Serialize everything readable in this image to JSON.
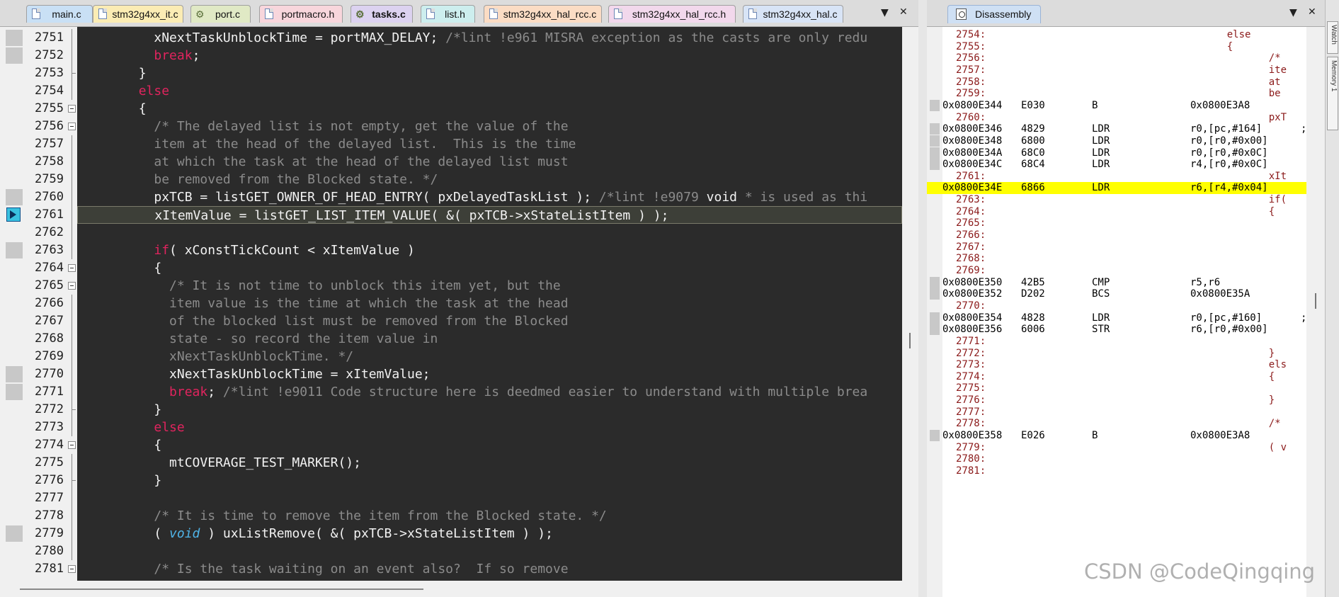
{
  "editor": {
    "tabs": [
      {
        "label": "main.c",
        "color": "#c9e0f5",
        "icon": "file-icon"
      },
      {
        "label": "stm32g4xx_it.c",
        "color": "#fbecb4",
        "icon": "file-icon"
      },
      {
        "label": "port.c",
        "color": "#e0e9c5",
        "icon": "gear-icon"
      },
      {
        "label": "portmacro.h",
        "color": "#f8d6dc",
        "icon": "file-icon"
      },
      {
        "label": "tasks.c",
        "color": "#dcd2f0",
        "icon": "gear-icon",
        "active": true
      },
      {
        "label": "list.h",
        "color": "#cdeeee",
        "icon": "file-icon"
      },
      {
        "label": "stm32g4xx_hal_rcc.c",
        "color": "#fbdcc4",
        "icon": "file-icon"
      },
      {
        "label": "stm32g4xx_hal_rcc.h",
        "color": "#f2d8ec",
        "icon": "file-icon"
      },
      {
        "label": "stm32g4xx_hal.c",
        "color": "#d8e4f6",
        "icon": "file-icon"
      }
    ],
    "dropdown_glyph": "▼",
    "close_glyph": "✕",
    "lines": [
      {
        "n": "2751",
        "mark": true,
        "tokens": [
          [
            "pl",
            "          xNextTaskUnblockTime = portMAX_DELAY; "
          ],
          [
            "cm",
            "/*lint !e961 MISRA exception as the casts are only redu"
          ]
        ]
      },
      {
        "n": "2752",
        "mark": true,
        "tokens": [
          [
            "kw",
            "          break"
          ],
          [
            "pl",
            ";"
          ]
        ]
      },
      {
        "n": "2753",
        "mark": false,
        "tokens": [
          [
            "pl",
            "        }"
          ]
        ]
      },
      {
        "n": "2754",
        "mark": false,
        "tokens": [
          [
            "kw",
            "        else"
          ]
        ]
      },
      {
        "n": "2755",
        "mark": false,
        "tokens": [
          [
            "pl",
            "        {"
          ]
        ]
      },
      {
        "n": "2756",
        "mark": false,
        "tokens": [
          [
            "cm",
            "          /* The delayed list is not empty, get the value of the"
          ]
        ]
      },
      {
        "n": "2757",
        "mark": false,
        "tokens": [
          [
            "cm",
            "          item at the head of the delayed list.  This is the time"
          ]
        ]
      },
      {
        "n": "2758",
        "mark": false,
        "tokens": [
          [
            "cm",
            "          at which the task at the head of the delayed list must"
          ]
        ]
      },
      {
        "n": "2759",
        "mark": false,
        "tokens": [
          [
            "cm",
            "          be removed from the Blocked state. */"
          ]
        ]
      },
      {
        "n": "2760",
        "mark": true,
        "tokens": [
          [
            "pl",
            "          pxTCB = listGET_OWNER_OF_HEAD_ENTRY( pxDelayedTaskList ); "
          ],
          [
            "cm",
            "/*lint !e9079 "
          ],
          [
            "pl",
            "void"
          ],
          [
            "cm",
            " * is used as thi"
          ]
        ]
      },
      {
        "n": "2761",
        "mark": false,
        "current": true,
        "tokens": [
          [
            "pl",
            "          xItemValue = listGET_LIST_ITEM_VALUE( &( pxTCB->xStateListItem ) );"
          ]
        ]
      },
      {
        "n": "2762",
        "mark": false,
        "tokens": [
          [
            "pl",
            ""
          ]
        ]
      },
      {
        "n": "2763",
        "mark": true,
        "tokens": [
          [
            "kw",
            "          if"
          ],
          [
            "pl",
            "( xConstTickCount < xItemValue )"
          ]
        ]
      },
      {
        "n": "2764",
        "mark": false,
        "tokens": [
          [
            "pl",
            "          {"
          ]
        ]
      },
      {
        "n": "2765",
        "mark": false,
        "tokens": [
          [
            "cm",
            "            /* It is not time to unblock this item yet, but the"
          ]
        ]
      },
      {
        "n": "2766",
        "mark": false,
        "tokens": [
          [
            "cm",
            "            item value is the time at which the task at the head"
          ]
        ]
      },
      {
        "n": "2767",
        "mark": false,
        "tokens": [
          [
            "cm",
            "            of the blocked list must be removed from the Blocked"
          ]
        ]
      },
      {
        "n": "2768",
        "mark": false,
        "tokens": [
          [
            "cm",
            "            state - so record the item value in"
          ]
        ]
      },
      {
        "n": "2769",
        "mark": false,
        "tokens": [
          [
            "cm",
            "            xNextTaskUnblockTime. */"
          ]
        ]
      },
      {
        "n": "2770",
        "mark": true,
        "tokens": [
          [
            "pl",
            "            xNextTaskUnblockTime = xItemValue;"
          ]
        ]
      },
      {
        "n": "2771",
        "mark": true,
        "tokens": [
          [
            "kw",
            "            break"
          ],
          [
            "pl",
            "; "
          ],
          [
            "cm",
            "/*lint !e9011 Code structure here is deedmed easier to understand with multiple brea"
          ]
        ]
      },
      {
        "n": "2772",
        "mark": false,
        "tokens": [
          [
            "pl",
            "          }"
          ]
        ]
      },
      {
        "n": "2773",
        "mark": false,
        "tokens": [
          [
            "kw",
            "          else"
          ]
        ]
      },
      {
        "n": "2774",
        "mark": false,
        "tokens": [
          [
            "pl",
            "          {"
          ]
        ]
      },
      {
        "n": "2775",
        "mark": false,
        "tokens": [
          [
            "pl",
            "            mtCOVERAGE_TEST_MARKER();"
          ]
        ]
      },
      {
        "n": "2776",
        "mark": false,
        "tokens": [
          [
            "pl",
            "          }"
          ]
        ]
      },
      {
        "n": "2777",
        "mark": false,
        "tokens": [
          [
            "pl",
            ""
          ]
        ]
      },
      {
        "n": "2778",
        "mark": false,
        "tokens": [
          [
            "cm",
            "          /* It is time to remove the item from the Blocked state. */"
          ]
        ]
      },
      {
        "n": "2779",
        "mark": true,
        "tokens": [
          [
            "pl",
            "          ( "
          ],
          [
            "ty",
            "void"
          ],
          [
            "pl",
            " ) uxListRemove( &( pxTCB->xStateListItem ) );"
          ]
        ]
      },
      {
        "n": "2780",
        "mark": false,
        "tokens": [
          [
            "pl",
            ""
          ]
        ]
      },
      {
        "n": "2781",
        "mark": false,
        "tokens": [
          [
            "cm",
            "          /* Is the task waiting on an event also?  If so remove"
          ]
        ]
      }
    ]
  },
  "disassembly": {
    "tab_label": "Disassembly",
    "dropdown_glyph": "▼",
    "close_glyph": "✕",
    "rows": [
      {
        "kind": "src",
        "ln": "2754:",
        "txt": "    else"
      },
      {
        "kind": "src",
        "ln": "2755:",
        "txt": "    {"
      },
      {
        "kind": "src",
        "ln": "2756:",
        "txt": "           /*"
      },
      {
        "kind": "src",
        "ln": "2757:",
        "txt": "           ite"
      },
      {
        "kind": "src",
        "ln": "2758:",
        "txt": "           at"
      },
      {
        "kind": "src",
        "ln": "2759:",
        "txt": "           be"
      },
      {
        "kind": "ins",
        "addr": "0x0800E344",
        "op": "E030",
        "mn": "B",
        "args": "0x0800E3A8",
        "cmt": ""
      },
      {
        "kind": "src",
        "ln": "2760:",
        "txt": "           pxT"
      },
      {
        "kind": "ins",
        "addr": "0x0800E346",
        "op": "4829",
        "mn": "LDR",
        "args": "r0,[pc,#164]",
        "cmt": ";"
      },
      {
        "kind": "ins",
        "addr": "0x0800E348",
        "op": "6800",
        "mn": "LDR",
        "args": "r0,[r0,#0x00]",
        "cmt": ""
      },
      {
        "kind": "ins",
        "addr": "0x0800E34A",
        "op": "68C0",
        "mn": "LDR",
        "args": "r0,[r0,#0x0C]",
        "cmt": ""
      },
      {
        "kind": "ins",
        "addr": "0x0800E34C",
        "op": "68C4",
        "mn": "LDR",
        "args": "r4,[r0,#0x0C]",
        "cmt": ""
      },
      {
        "kind": "src",
        "ln": "2761:",
        "txt": "           xIt"
      },
      {
        "kind": "ins",
        "addr": "0x0800E34E",
        "op": "6866",
        "mn": "LDR",
        "args": "r6,[r4,#0x04]",
        "cmt": "",
        "current": true
      },
      {
        "kind": "src",
        "ln": "2763:",
        "txt": "           if("
      },
      {
        "kind": "src",
        "ln": "2764:",
        "txt": "           {"
      },
      {
        "kind": "src",
        "ln": "2765:",
        "txt": ""
      },
      {
        "kind": "src",
        "ln": "2766:",
        "txt": ""
      },
      {
        "kind": "src",
        "ln": "2767:",
        "txt": ""
      },
      {
        "kind": "src",
        "ln": "2768:",
        "txt": ""
      },
      {
        "kind": "src",
        "ln": "2769:",
        "txt": ""
      },
      {
        "kind": "ins",
        "addr": "0x0800E350",
        "op": "42B5",
        "mn": "CMP",
        "args": "r5,r6",
        "cmt": ""
      },
      {
        "kind": "ins",
        "addr": "0x0800E352",
        "op": "D202",
        "mn": "BCS",
        "args": "0x0800E35A",
        "cmt": ""
      },
      {
        "kind": "src",
        "ln": "2770:",
        "txt": ""
      },
      {
        "kind": "ins",
        "addr": "0x0800E354",
        "op": "4828",
        "mn": "LDR",
        "args": "r0,[pc,#160]",
        "cmt": ";"
      },
      {
        "kind": "ins",
        "addr": "0x0800E356",
        "op": "6006",
        "mn": "STR",
        "args": "r6,[r0,#0x00]",
        "cmt": ""
      },
      {
        "kind": "src",
        "ln": "2771:",
        "txt": ""
      },
      {
        "kind": "src",
        "ln": "2772:",
        "txt": "           }"
      },
      {
        "kind": "src",
        "ln": "2773:",
        "txt": "           els"
      },
      {
        "kind": "src",
        "ln": "2774:",
        "txt": "           {"
      },
      {
        "kind": "src",
        "ln": "2775:",
        "txt": ""
      },
      {
        "kind": "src",
        "ln": "2776:",
        "txt": "           }"
      },
      {
        "kind": "src",
        "ln": "2777:",
        "txt": ""
      },
      {
        "kind": "src",
        "ln": "2778:",
        "txt": "           /*"
      },
      {
        "kind": "ins",
        "addr": "0x0800E358",
        "op": "E026",
        "mn": "B",
        "args": "0x0800E3A8",
        "cmt": ""
      },
      {
        "kind": "src",
        "ln": "2779:",
        "txt": "           ( v"
      },
      {
        "kind": "src",
        "ln": "2780:",
        "txt": ""
      },
      {
        "kind": "src",
        "ln": "2781:",
        "txt": ""
      }
    ]
  },
  "side_dock": {
    "tabs": [
      {
        "label": "Watch"
      },
      {
        "label": "Memory 1"
      }
    ]
  },
  "watermark": "CSDN @CodeQingqing",
  "colors": {
    "current_line_highlight": "#ffff00",
    "code_background": "#2b2b2b",
    "keyword": "#e0245e",
    "comment": "#8b8b8b",
    "source_line_text": "#8b1a1a"
  }
}
